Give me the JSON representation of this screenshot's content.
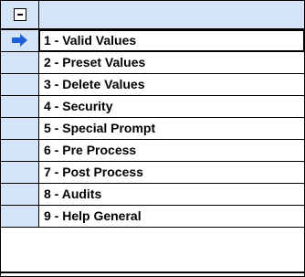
{
  "grid": {
    "header": {
      "collapse_icon": "minus-box-icon"
    },
    "selected_index": 0,
    "row_indicator_icon": "right-arrow-icon",
    "rows": [
      {
        "label": "1 - Valid Values"
      },
      {
        "label": "2 - Preset Values"
      },
      {
        "label": "3 - Delete Values"
      },
      {
        "label": "4 - Security"
      },
      {
        "label": "5 - Special Prompt"
      },
      {
        "label": "6 - Pre Process"
      },
      {
        "label": "7 - Post Process"
      },
      {
        "label": "8 - Audits"
      },
      {
        "label": "9 - Help General"
      }
    ]
  },
  "colors": {
    "header_bg": "#d4e4f7",
    "arrow": "#1f5fd6",
    "grid_line": "#000000"
  }
}
